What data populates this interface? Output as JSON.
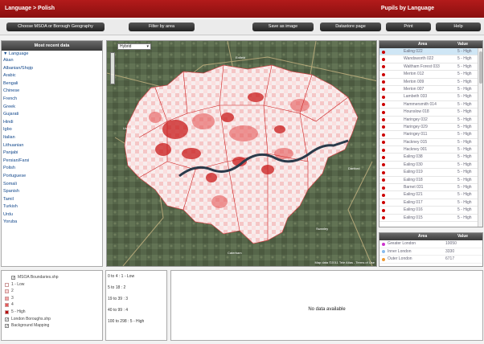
{
  "header": {
    "breadcrumb": "Language > Polish",
    "title": "Pupils by Language"
  },
  "toolbar": {
    "choose": "Choose MSOA or Borough Geography",
    "filter": "Filter by area",
    "save": "Save as image",
    "datastore": "Datastore page",
    "print": "Print",
    "help": "Help"
  },
  "left_panel": {
    "title": "Most recent data",
    "group": "Language",
    "languages": [
      "Akan",
      "Albanian/Shqip",
      "Arabic",
      "Bengali",
      "Chinese",
      "French",
      "Greek",
      "Gujarati",
      "Hindi",
      "Igbo",
      "Italian",
      "Lithuanian",
      "Panjabi",
      "Persian/Farsi",
      "Polish",
      "Portuguese",
      "Somali",
      "Spanish",
      "Tamil",
      "Turkish",
      "Urdu",
      "Yoruba"
    ]
  },
  "map": {
    "map_type": "Hybrid",
    "copyright": "Map data ©2011 Tele Atlas - Terms of Use"
  },
  "area_table": {
    "headers": {
      "area": "Area",
      "value": "Value"
    },
    "rows": [
      {
        "area": "Ealing 022",
        "value": "5 - High"
      },
      {
        "area": "Wandsworth 022",
        "value": "5 - High"
      },
      {
        "area": "Waltham Forest 033",
        "value": "5 - High"
      },
      {
        "area": "Merton 012",
        "value": "5 - High"
      },
      {
        "area": "Merton 009",
        "value": "5 - High"
      },
      {
        "area": "Merton 007",
        "value": "5 - High"
      },
      {
        "area": "Lambeth 033",
        "value": "5 - High"
      },
      {
        "area": "Hammersmith 014",
        "value": "5 - High"
      },
      {
        "area": "Hounslow 018",
        "value": "5 - High"
      },
      {
        "area": "Haringey 032",
        "value": "5 - High"
      },
      {
        "area": "Haringey 029",
        "value": "5 - High"
      },
      {
        "area": "Haringey 011",
        "value": "5 - High"
      },
      {
        "area": "Hackney 015",
        "value": "5 - High"
      },
      {
        "area": "Hackney 001",
        "value": "5 - High"
      },
      {
        "area": "Ealing 038",
        "value": "5 - High"
      },
      {
        "area": "Ealing 030",
        "value": "5 - High"
      },
      {
        "area": "Ealing 019",
        "value": "5 - High"
      },
      {
        "area": "Ealing 018",
        "value": "5 - High"
      },
      {
        "area": "Barnet 031",
        "value": "5 - High"
      },
      {
        "area": "Ealing 021",
        "value": "5 - High"
      },
      {
        "area": "Ealing 017",
        "value": "5 - High"
      },
      {
        "area": "Ealing 016",
        "value": "5 - High"
      },
      {
        "area": "Ealing 015",
        "value": "5 - High"
      }
    ]
  },
  "summary_table": {
    "headers": {
      "area": "Area",
      "value": "Value"
    },
    "rows": [
      {
        "area": "Greater London",
        "value": "10050",
        "color": "#cc33cc"
      },
      {
        "area": "Inner London",
        "value": "3330",
        "color": "#88bbee"
      },
      {
        "area": "Outer London",
        "value": "6717",
        "color": "#ee9933"
      }
    ]
  },
  "legend": {
    "layer1": "MSOA Boundaries.shp",
    "items": [
      {
        "label": "1 - Low",
        "color": "#ffffff"
      },
      {
        "label": "2",
        "color": "#fbd5d5"
      },
      {
        "label": "3",
        "color": "#f4a3a3"
      },
      {
        "label": "4",
        "color": "#e65a5a"
      },
      {
        "label": "5 - High",
        "color": "#b50e0e"
      }
    ],
    "layer2": "London Boroughs.shp",
    "layer3": "Background Mapping"
  },
  "ranges": [
    "0 to 4 : 1 - Low",
    "5 to 18 : 2",
    "19 to 39 : 3",
    "40 to 99 : 4",
    "100 to 298 : 5 - High"
  ],
  "info": {
    "no_data": "No data available"
  }
}
